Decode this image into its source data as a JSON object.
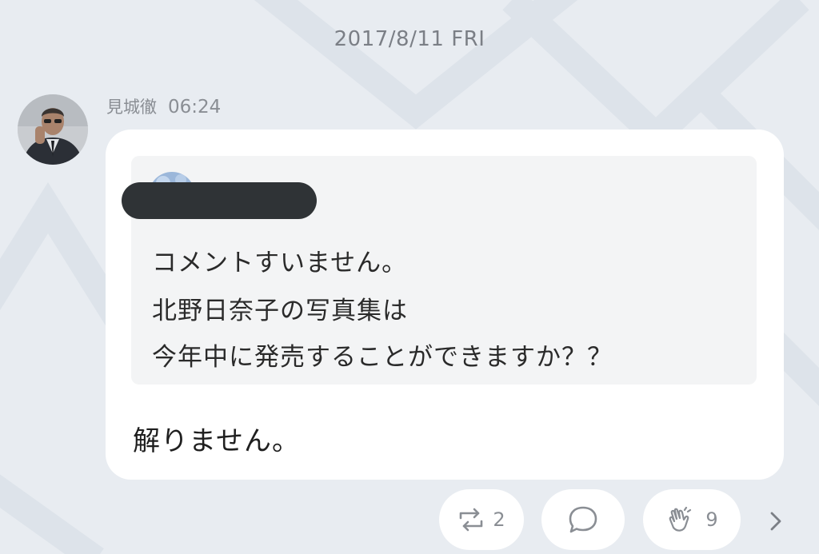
{
  "date_header": "2017/8/11 FRI",
  "message": {
    "sender_name": "見城徹",
    "time": "06:24",
    "quoted_comment": {
      "lines": [
        "コメントすいません。",
        "北野日奈子の写真集は",
        "今年中に発売することができますか？？"
      ]
    },
    "reply": "解りません。"
  },
  "actions": {
    "repost_count": "2",
    "clap_count": "9",
    "icons": [
      "repost-icon",
      "comment-icon",
      "clap-icon",
      "chevron-right-icon"
    ]
  },
  "colors": {
    "background": "#e8ecf1",
    "bubble": "#ffffff",
    "quote_background": "#f3f4f5",
    "muted_text": "#8a8e94",
    "redaction": "#2f3336"
  }
}
